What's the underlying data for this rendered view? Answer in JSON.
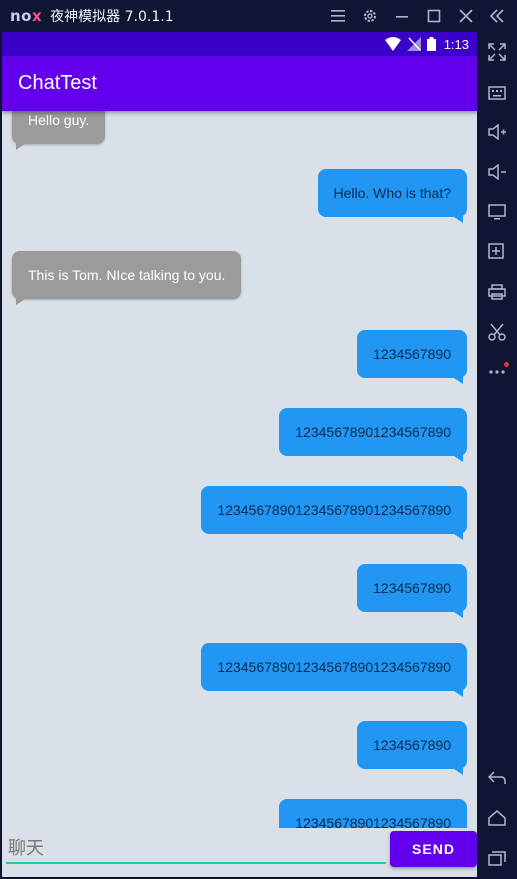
{
  "emulator": {
    "logo": "nox",
    "title": "夜神模拟器 7.0.1.1",
    "titlebar_icons": [
      "menu-icon",
      "gear-icon",
      "minimize-icon",
      "maximize-icon",
      "close-icon",
      "collapse-icon"
    ],
    "side_icons": [
      "fullscreen-icon",
      "keyboard-icon",
      "volume-up-icon",
      "volume-down-icon",
      "screen-icon",
      "apk-icon",
      "printer-icon",
      "scissors-icon",
      "more-icon",
      "back-icon",
      "home-icon",
      "recents-icon"
    ]
  },
  "status_bar": {
    "time": "1:13",
    "icons": [
      "wifi-icon",
      "signal-icon",
      "battery-icon"
    ]
  },
  "app_bar": {
    "title": "ChatTest"
  },
  "messages": [
    {
      "side": "in",
      "text": "Hello guy."
    },
    {
      "side": "out",
      "text": "Hello. Who is that?"
    },
    {
      "side": "in",
      "text": "This is Tom. NIce talking to you."
    },
    {
      "side": "out",
      "text": "1234567890"
    },
    {
      "side": "out",
      "text": "12345678901234567890"
    },
    {
      "side": "out",
      "text": "123456789012345678901234567890"
    },
    {
      "side": "out",
      "text": "1234567890"
    },
    {
      "side": "out",
      "text": "123456789012345678901234567890"
    },
    {
      "side": "out",
      "text": "1234567890"
    },
    {
      "side": "out",
      "text": "12345678901234567890"
    }
  ],
  "input": {
    "placeholder": "聊天",
    "value": ""
  },
  "send_button": {
    "label": "SEND"
  },
  "colors": {
    "app_bar": "#6200ee",
    "status_bar": "#3b00c9",
    "outgoing_bubble": "#2196f3",
    "incoming_bubble": "#9b9b9b",
    "background": "#d9e0e8",
    "input_underline": "#26c6b5"
  }
}
